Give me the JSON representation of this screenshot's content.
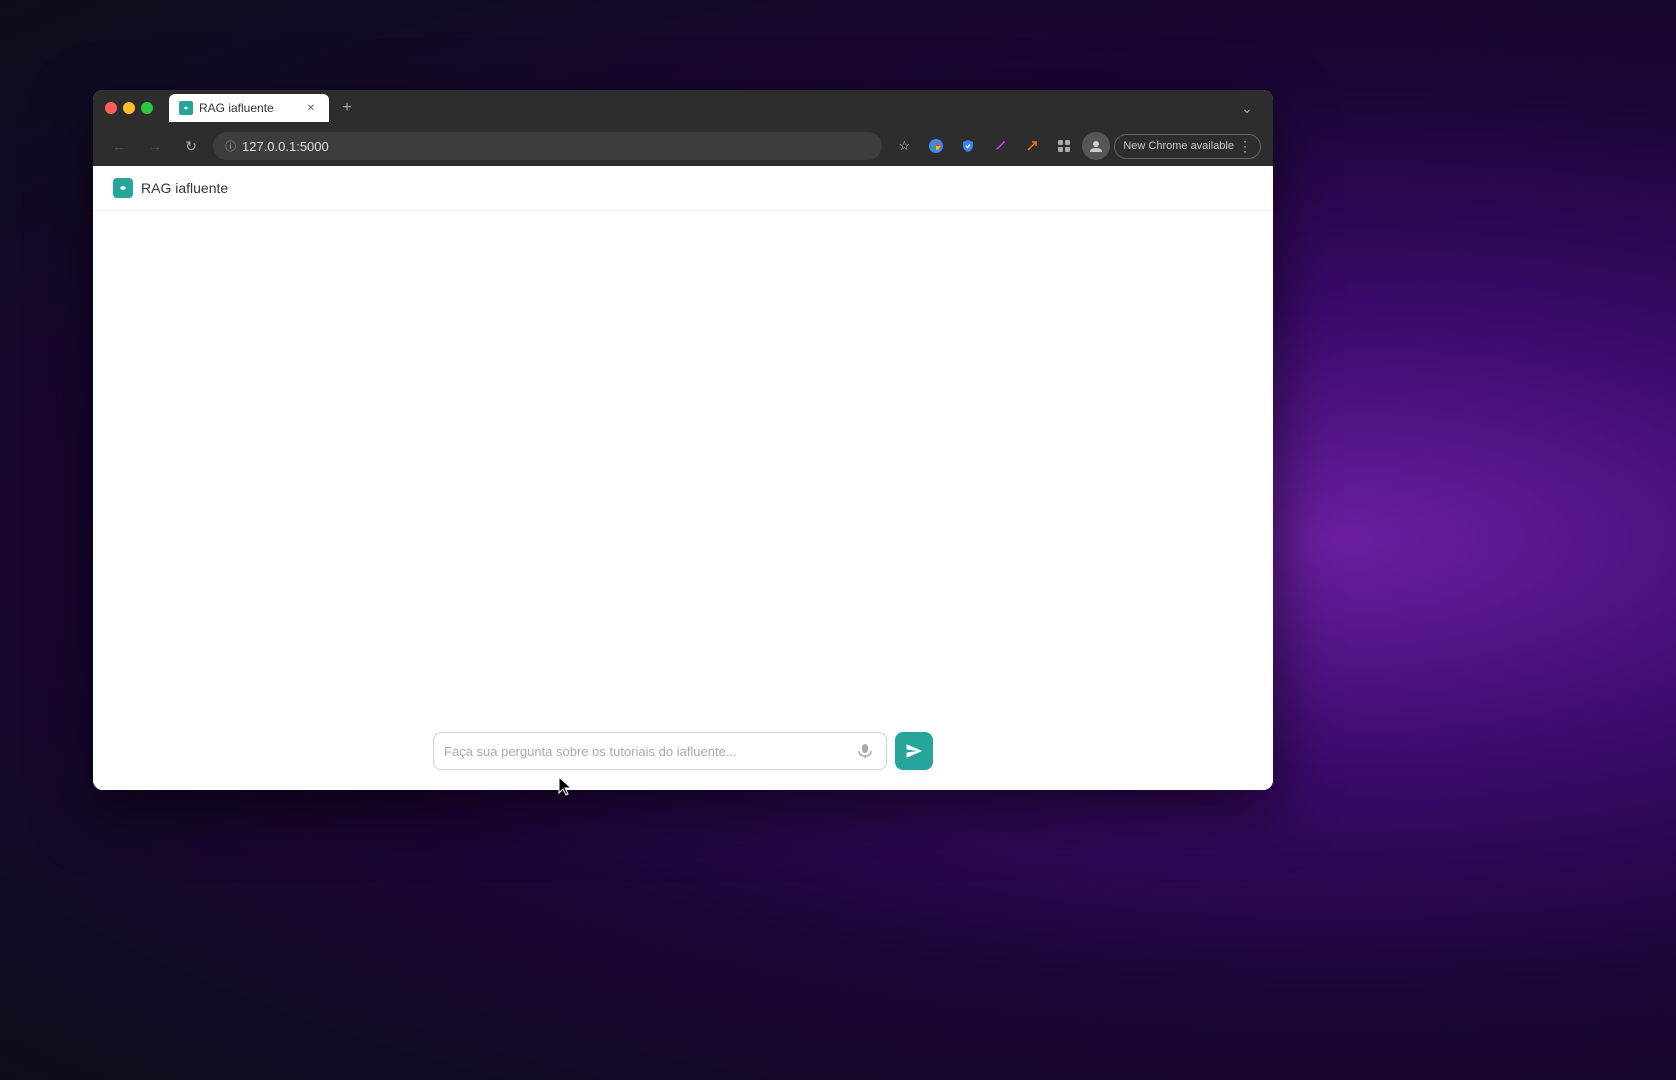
{
  "desktop": {
    "background": "radial-gradient purple"
  },
  "browser": {
    "title_bar": {
      "traffic_lights": {
        "close": "close",
        "minimize": "minimize",
        "maximize": "maximize"
      },
      "window_control_label": "⌄"
    },
    "tabs": [
      {
        "label": "RAG iafluente",
        "active": true,
        "favicon": "🌿"
      }
    ],
    "new_tab_label": "+",
    "nav": {
      "back_label": "←",
      "forward_label": "→",
      "reload_label": "↻",
      "address": "127.0.0.1:5000",
      "address_icon": "ⓘ",
      "bookmark_icon": "☆",
      "extensions_icon": "🧩",
      "profile_icon": "👤",
      "new_chrome_label": "New Chrome available",
      "more_icon": "⋮"
    },
    "page": {
      "logo_icon": "🌿",
      "title": "RAG iafluente",
      "input_placeholder": "Faça sua pergunta sobre os tutoriais do iafluente...",
      "mic_icon": "🎤",
      "send_icon": "send"
    }
  },
  "notification": {
    "label": "New Chrome available"
  }
}
